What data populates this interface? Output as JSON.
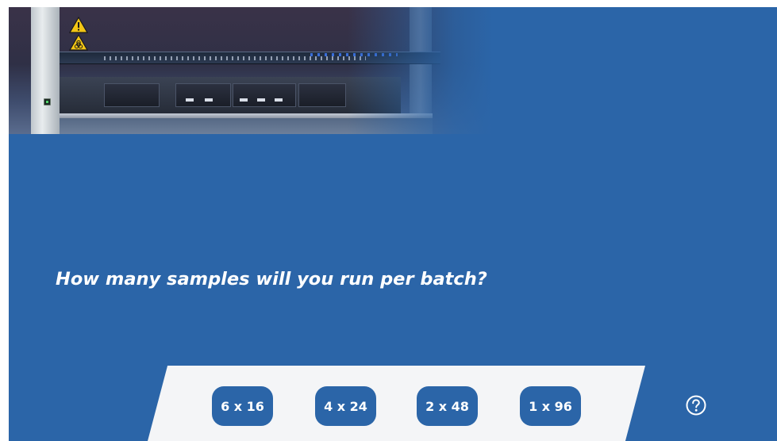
{
  "question": {
    "text": "How many samples will you run per batch?"
  },
  "options": [
    {
      "label": "6 x 16"
    },
    {
      "label": "4 x 24"
    },
    {
      "label": "2 x 48"
    },
    {
      "label": "1 x 96"
    }
  ],
  "help": {
    "icon": "help-circle-icon"
  },
  "hero_image": {
    "icons": [
      "warning-triangle-icon",
      "biohazard-warning-icon"
    ]
  },
  "colors": {
    "background": "#2b65a8",
    "panel": "#f4f5f7",
    "button": "#2b65a8",
    "text": "#ffffff",
    "warning": "#f3c515"
  }
}
